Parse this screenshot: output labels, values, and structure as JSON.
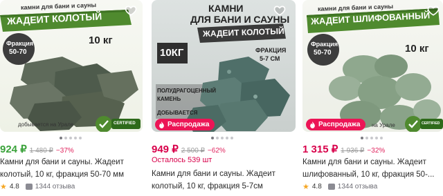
{
  "cards": [
    {
      "image": {
        "small_title": "камни для бани и сауны",
        "banner": "ЖАДЕИТ КОЛОТЫЙ",
        "fraction_label": "Фракция",
        "fraction_value": "50-70",
        "weight": "10 кг",
        "origin": "добывается на Урале",
        "certified": "CERTIFIED"
      },
      "price": "924 ₽",
      "old_price": "1 480 ₽",
      "discount": "−37%",
      "title": "Камни для бани и сауны. Жадеит колотый, 10 кг, фракция 50-70 мм",
      "rating": "4.8",
      "reviews": "1344 отзыва",
      "accent": "#3aa23a"
    },
    {
      "image": {
        "title_line1": "КАМНИ",
        "title_line2": "ДЛЯ БАНИ И САУНЫ",
        "ribbon": "ЖАДЕИТ КОЛОТЫЙ",
        "weight": "10КГ",
        "fraction_label": "ФРАКЦИЯ",
        "fraction_value": "5-7 СМ",
        "note_line1": "ПОЛУДРАГОЦЕННЫЙ",
        "note_line2": "КАМЕНЬ",
        "note_line3": "ДОБЫВАЕТСЯ"
      },
      "sale_badge": "Распродажа",
      "price": "949 ₽",
      "old_price": "2 500 ₽",
      "discount": "−62%",
      "left_in_stock": "Осталось 539 шт",
      "title": "Камни для бани и сауны. Жадеит колотый, 10 кг, фракция 5-7см",
      "accent": "#d8004a"
    },
    {
      "image": {
        "small_title": "камни для бани и сауны",
        "banner": "ЖАДЕИТ ШЛИФОВАННЫЙ",
        "fraction_label": "Фракция",
        "fraction_value": "50-70",
        "weight": "10 кг",
        "origin": "на Урале",
        "certified": "CERTIFIED"
      },
      "sale_badge": "Распродажа",
      "price": "1 315 ₽",
      "old_price": "1 936 ₽",
      "discount": "−32%",
      "title": "Камни для бани и сауны. Жадеит шлифованный, 10 кг, фракция 50-...",
      "rating": "4.8",
      "reviews": "1344 отзыва",
      "accent": "#d8004a"
    }
  ]
}
